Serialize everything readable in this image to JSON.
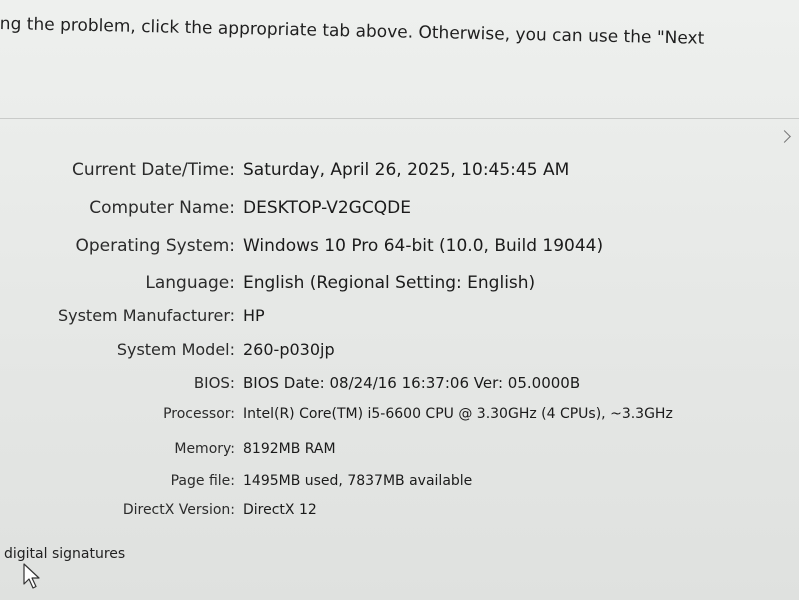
{
  "intro": {
    "text": "ng the problem, click the appropriate tab above.  Otherwise, you can use the \"Next"
  },
  "system_info": [
    {
      "label": "Current Date/Time:",
      "value": "Saturday, April 26, 2025, 10:45:45 AM"
    },
    {
      "label": "Computer Name:",
      "value": "DESKTOP-V2GCQDE"
    },
    {
      "label": "Operating System:",
      "value": "Windows 10 Pro 64-bit (10.0, Build 19044)"
    },
    {
      "label": "Language:",
      "value": "English (Regional Setting: English)"
    },
    {
      "label": "System Manufacturer:",
      "value": "HP"
    },
    {
      "label": "System Model:",
      "value": "260-p030jp"
    },
    {
      "label": "BIOS:",
      "value": "BIOS Date: 08/24/16 16:37:06 Ver: 05.0000B"
    },
    {
      "label": "Processor:",
      "value": "Intel(R) Core(TM) i5-6600 CPU @ 3.30GHz (4 CPUs), ~3.3GHz"
    },
    {
      "label": "Memory:",
      "value": "8192MB RAM"
    },
    {
      "label": "Page file:",
      "value": "1495MB used, 7837MB available"
    },
    {
      "label": "DirectX Version:",
      "value": "DirectX 12"
    }
  ],
  "footer": {
    "link_text": "digital signatures"
  },
  "icons": {
    "cursor": "mouse-pointer-icon",
    "scroll": "chevron-up-icon"
  }
}
